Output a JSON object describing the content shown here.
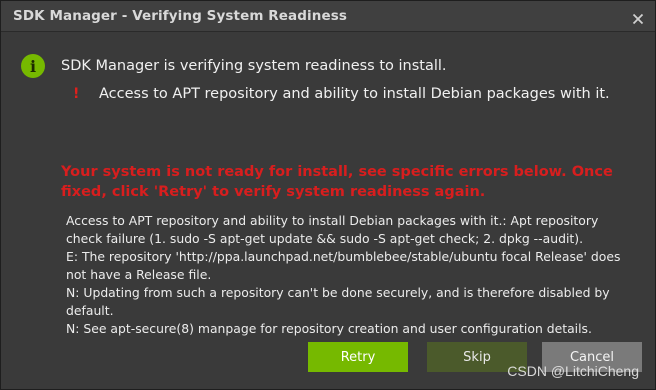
{
  "window": {
    "title": "SDK Manager - Verifying System Readiness",
    "close_icon": "close-icon"
  },
  "status": {
    "icon": "info-icon",
    "icon_glyph": "i",
    "message": "SDK Manager is verifying system readiness to install."
  },
  "checks": [
    {
      "icon": "error-exclamation-icon",
      "glyph": "!",
      "label": "Access to APT repository and ability to install Debian packages with it."
    }
  ],
  "error_headline": "Your system is not ready for install, see specific errors below. Once fixed, click 'Retry' to verify system readiness again.",
  "details": [
    "Access to APT repository and ability to install Debian packages with it.: Apt repository check failure (1. sudo -S apt-get update && sudo -S apt-get check; 2. dpkg --audit).",
    "E: The repository 'http://ppa.launchpad.net/bumblebee/stable/ubuntu focal Release' does not have a Release file.",
    "N: Updating from such a repository can't be done securely, and is therefore disabled by default.",
    "N: See apt-secure(8) manpage for repository creation and user configuration details."
  ],
  "buttons": {
    "retry": "Retry",
    "skip": "Skip",
    "cancel": "Cancel"
  },
  "watermark": "CSDN @LitchiCheng",
  "colors": {
    "accent": "#76b900",
    "error": "#d81e1e",
    "dialog_bg": "#3a3a3a",
    "titlebar_bg": "#404040"
  }
}
